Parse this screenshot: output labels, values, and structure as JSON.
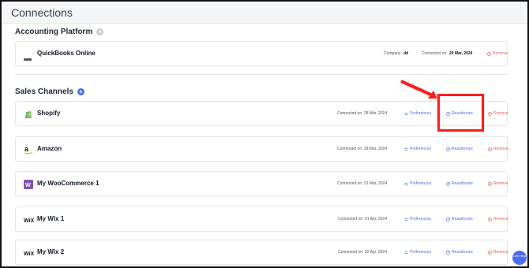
{
  "page": {
    "title": "Connections"
  },
  "accounting": {
    "section_title": "Accounting Platform",
    "row": {
      "name": "QuickBooks Online",
      "logo_text": "qb",
      "company_label": "Company:",
      "company_value": "dd",
      "connected_label": "Connected on:",
      "connected_value": "20 Mar, 2024",
      "remove_label": "Remove"
    }
  },
  "sales": {
    "section_title": "Sales Channels",
    "rows": [
      {
        "name": "Shopify",
        "connected": "Connected on: 28 Mar, 2024",
        "preferences": "Preferences",
        "reauthorize": "Reauthorize",
        "remove": "Remove"
      },
      {
        "name": "Amazon",
        "connected": "Connected on: 28 Mar, 2024",
        "preferences": "Preferences",
        "reauthorize": "Reauthorize",
        "remove": "Remove"
      },
      {
        "name": "My WooCommerce 1",
        "connected": "Connected on: 31 Mar, 2024",
        "preferences": "Preferences",
        "reauthorize": "Reauthorize",
        "remove": "Remove"
      },
      {
        "name": "My Wix 1",
        "connected": "Connected on: 01 Apr, 2024",
        "preferences": "Preferences",
        "reauthorize": "Reauthorize",
        "remove": "Remove"
      },
      {
        "name": "My Wix 2",
        "connected": "Connected on: 02 Apr, 2024",
        "preferences": "Preferences",
        "reauthorize": "Reauthorize",
        "remove": "Remove"
      }
    ]
  },
  "fab": {
    "label": "Live Help"
  },
  "colors": {
    "accent": "#4f6bed",
    "danger": "#e15b4c",
    "highlight": "#ff1a1a"
  }
}
